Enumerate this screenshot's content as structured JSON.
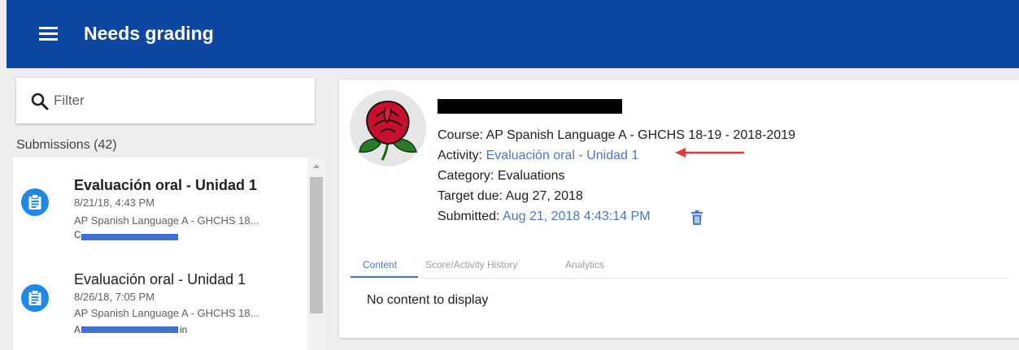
{
  "header": {
    "title": "Needs grading",
    "menu_icon": "hamburger-menu-icon"
  },
  "filter": {
    "placeholder": "Filter",
    "value": "",
    "icon": "search-icon"
  },
  "submissions": {
    "header": "Submissions (42)",
    "items": [
      {
        "title": "Evaluación oral - Unidad 1",
        "date": "8/21/18, 4:43 PM",
        "course": "AP Spanish Language A - GHCHS 18...",
        "student_visible": "C",
        "unread": true,
        "icon": "assignment-clipboard-icon"
      },
      {
        "title": "Evaluación oral - Unidad 1",
        "date": "8/26/18, 7:05 PM",
        "course": "AP Spanish Language A - GHCHS 18...",
        "student_visible_start": "A",
        "student_visible_end": "in",
        "unread": false,
        "icon": "assignment-clipboard-icon"
      }
    ]
  },
  "detail": {
    "avatar_icon": "red-rose-avatar",
    "course_label": "Course:",
    "course_value": "AP Spanish Language A - GHCHS 18-19 - 2018-2019",
    "activity_label": "Activity:",
    "activity_value": "Evaluación oral - Unidad 1",
    "category_label": "Category:",
    "category_value": "Evaluations",
    "target_label": "Target due:",
    "target_value": "Aug 27, 2018",
    "submitted_label": "Submitted:",
    "submitted_value": "Aug 21, 2018 4:43:14 PM",
    "delete_icon": "trash-icon",
    "tabs": [
      {
        "label": "Content",
        "active": true
      },
      {
        "label": "Score/Activity History",
        "active": false
      },
      {
        "label": "Analytics",
        "active": false
      }
    ],
    "empty_message": "No content to display"
  },
  "colors": {
    "header_bg": "#0d47a1",
    "link": "#4a76c4",
    "submission_icon": "#1e88e5",
    "annotation_arrow": "#e53935",
    "redaction": "#3f6fd6"
  }
}
